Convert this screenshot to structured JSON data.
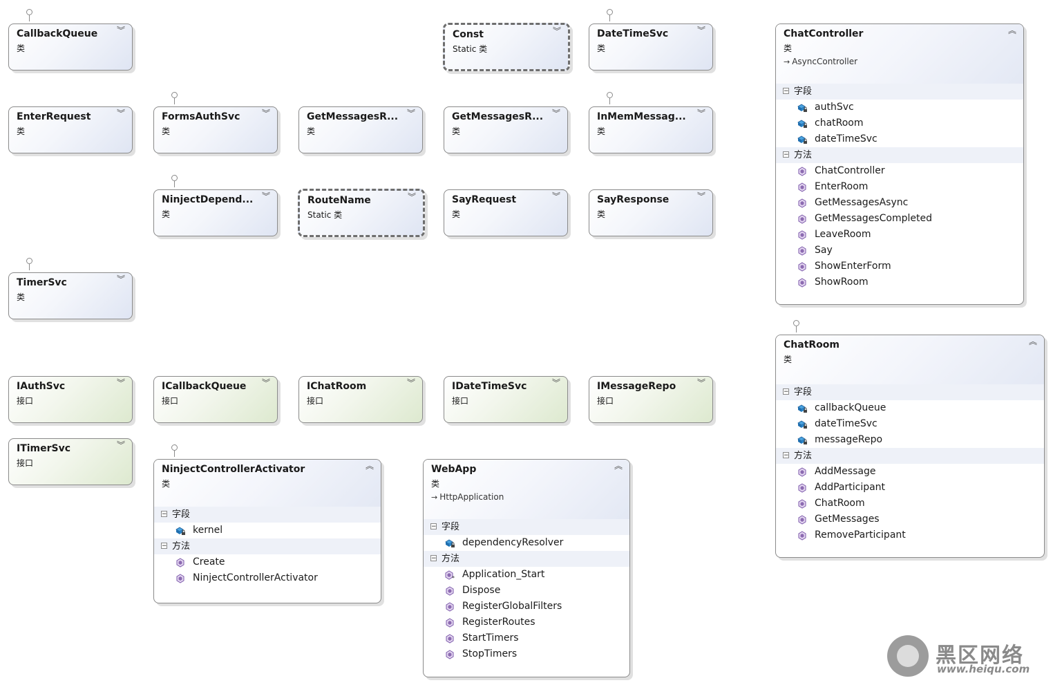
{
  "labels": {
    "class_kind": "类",
    "static_kind": "Static 类",
    "interface_kind": "接口",
    "fields_header": "字段",
    "methods_header": "方法"
  },
  "collapsed_boxes": {
    "callback_queue": "CallbackQueue",
    "const": "Const",
    "date_time_svc": "DateTimeSvc",
    "enter_request": "EnterRequest",
    "forms_auth_svc": "FormsAuthSvc",
    "get_messages_request": "GetMessagesR...",
    "get_messages_response": "GetMessagesR...",
    "in_mem_message_repo": "InMemMessag...",
    "ninject_dependency_resolver": "NinjectDepend...",
    "route_name": "RouteName",
    "say_request": "SayRequest",
    "say_response": "SayResponse",
    "timer_svc": "TimerSvc",
    "i_auth_svc": "IAuthSvc",
    "i_callback_queue": "ICallbackQueue",
    "i_chat_room": "IChatRoom",
    "i_date_time_svc": "IDateTimeSvc",
    "i_message_repo": "IMessageRepo",
    "i_timer_svc": "ITimerSvc"
  },
  "chat_controller": {
    "name": "ChatController",
    "base": "AsyncController",
    "fields": [
      "authSvc",
      "chatRoom",
      "dateTimeSvc"
    ],
    "methods": [
      "ChatController",
      "EnterRoom",
      "GetMessagesAsync",
      "GetMessagesCompleted",
      "LeaveRoom",
      "Say",
      "ShowEnterForm",
      "ShowRoom"
    ]
  },
  "chat_room": {
    "name": "ChatRoom",
    "fields": [
      "callbackQueue",
      "dateTimeSvc",
      "messageRepo"
    ],
    "methods": [
      "AddMessage",
      "AddParticipant",
      "ChatRoom",
      "GetMessages",
      "RemoveParticipant"
    ]
  },
  "ninject_controller_activator": {
    "name": "NinjectControllerActivator",
    "fields": [
      "kernel"
    ],
    "methods": [
      "Create",
      "NinjectControllerActivator"
    ]
  },
  "web_app": {
    "name": "WebApp",
    "base": "HttpApplication",
    "fields": [
      "dependencyResolver"
    ],
    "methods": [
      "Application_Start",
      "Dispose",
      "RegisterGlobalFilters",
      "RegisterRoutes",
      "StartTimers",
      "StopTimers"
    ]
  },
  "watermark": {
    "title": "黑区网络",
    "url": "www.heiqu.com"
  },
  "colors": {
    "class_gradient_end": "#dfe5f3",
    "interface_gradient_end": "#dde9cf",
    "border": "#8a8a8a",
    "section_bg": "#eef1f8",
    "method_icon": "#8c6bb1",
    "field_icon": "#2a6fb5"
  }
}
